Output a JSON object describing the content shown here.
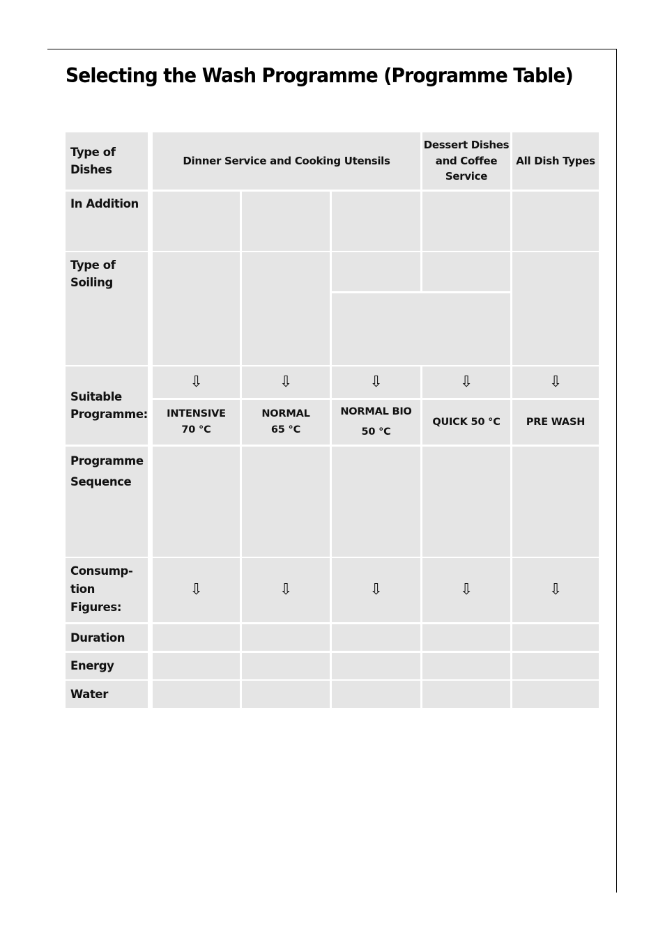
{
  "page": {
    "title": "Selecting the Wash Programme (Programme Table)"
  },
  "table": {
    "row_labels": {
      "type_of_dishes": "Type of\nDishes",
      "in_addition": "In Addition",
      "type_of_soiling": "Type of\nSoiling",
      "suitable_programme": "Suitable\nProgramme:",
      "programme_sequence": "Programme\nSequence",
      "consumption_figures": "Consump-\ntion\nFigures:",
      "duration": "Duration",
      "energy": "Energy",
      "water": "Water"
    },
    "dish_type_headers": [
      "Dinner Service and Cooking Utensils",
      "Dessert Dishes\nand Coffee\nService",
      "All Dish Types"
    ],
    "arrow_icon": "⇩",
    "programmes": [
      {
        "name": "INTENSIVE\n70 °C"
      },
      {
        "name": "NORMAL\n65 °C"
      },
      {
        "name": "NORMAL BIO\n50 °C"
      },
      {
        "name": "QUICK 50 °C"
      },
      {
        "name": "PRE WASH"
      }
    ]
  }
}
